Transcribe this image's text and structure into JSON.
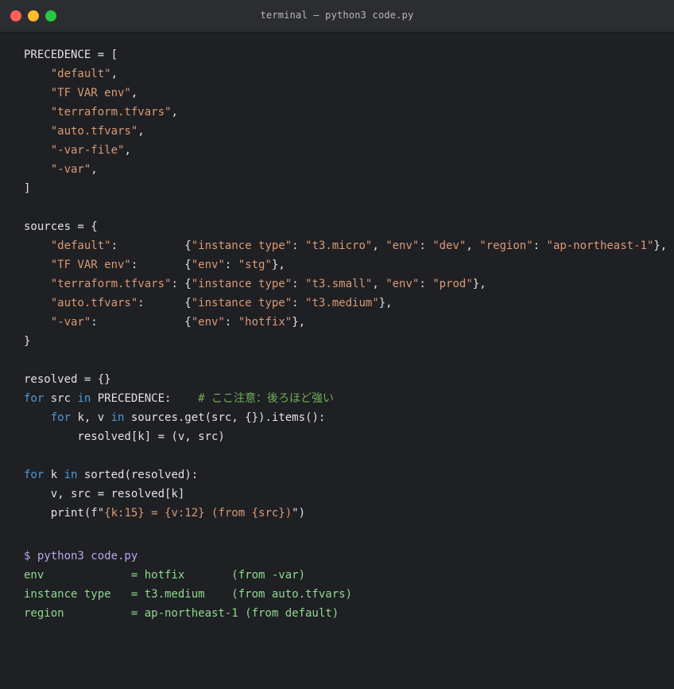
{
  "window": {
    "title": "terminal — python3 code.py"
  },
  "code_lines": [
    [
      {
        "t": "PRECEDENCE = [",
        "c": ""
      }
    ],
    [
      {
        "t": "    ",
        "c": ""
      },
      {
        "t": "\"default\"",
        "c": "str"
      },
      {
        "t": ",",
        "c": ""
      }
    ],
    [
      {
        "t": "    ",
        "c": ""
      },
      {
        "t": "\"TF VAR env\"",
        "c": "str"
      },
      {
        "t": ",",
        "c": ""
      }
    ],
    [
      {
        "t": "    ",
        "c": ""
      },
      {
        "t": "\"terraform.tfvars\"",
        "c": "str"
      },
      {
        "t": ",",
        "c": ""
      }
    ],
    [
      {
        "t": "    ",
        "c": ""
      },
      {
        "t": "\"auto.tfvars\"",
        "c": "str"
      },
      {
        "t": ",",
        "c": ""
      }
    ],
    [
      {
        "t": "    ",
        "c": ""
      },
      {
        "t": "\"-var-file\"",
        "c": "str"
      },
      {
        "t": ",",
        "c": ""
      }
    ],
    [
      {
        "t": "    ",
        "c": ""
      },
      {
        "t": "\"-var\"",
        "c": "str"
      },
      {
        "t": ",",
        "c": ""
      }
    ],
    [
      {
        "t": "]",
        "c": ""
      }
    ],
    [
      {
        "t": "",
        "c": ""
      }
    ],
    [
      {
        "t": "sources = {",
        "c": ""
      }
    ],
    [
      {
        "t": "    ",
        "c": ""
      },
      {
        "t": "\"default\"",
        "c": "str"
      },
      {
        "t": ":          {",
        "c": ""
      },
      {
        "t": "\"instance type\"",
        "c": "str"
      },
      {
        "t": ": ",
        "c": ""
      },
      {
        "t": "\"t3.micro\"",
        "c": "str"
      },
      {
        "t": ", ",
        "c": ""
      },
      {
        "t": "\"env\"",
        "c": "str"
      },
      {
        "t": ": ",
        "c": ""
      },
      {
        "t": "\"dev\"",
        "c": "str"
      },
      {
        "t": ", ",
        "c": ""
      },
      {
        "t": "\"region\"",
        "c": "str"
      },
      {
        "t": ": ",
        "c": ""
      },
      {
        "t": "\"ap-northeast-1\"",
        "c": "str"
      },
      {
        "t": "},",
        "c": ""
      }
    ],
    [
      {
        "t": "    ",
        "c": ""
      },
      {
        "t": "\"TF VAR env\"",
        "c": "str"
      },
      {
        "t": ":       {",
        "c": ""
      },
      {
        "t": "\"env\"",
        "c": "str"
      },
      {
        "t": ": ",
        "c": ""
      },
      {
        "t": "\"stg\"",
        "c": "str"
      },
      {
        "t": "},",
        "c": ""
      }
    ],
    [
      {
        "t": "    ",
        "c": ""
      },
      {
        "t": "\"terraform.tfvars\"",
        "c": "str"
      },
      {
        "t": ": {",
        "c": ""
      },
      {
        "t": "\"instance type\"",
        "c": "str"
      },
      {
        "t": ": ",
        "c": ""
      },
      {
        "t": "\"t3.small\"",
        "c": "str"
      },
      {
        "t": ", ",
        "c": ""
      },
      {
        "t": "\"env\"",
        "c": "str"
      },
      {
        "t": ": ",
        "c": ""
      },
      {
        "t": "\"prod\"",
        "c": "str"
      },
      {
        "t": "},",
        "c": ""
      }
    ],
    [
      {
        "t": "    ",
        "c": ""
      },
      {
        "t": "\"auto.tfvars\"",
        "c": "str"
      },
      {
        "t": ":      {",
        "c": ""
      },
      {
        "t": "\"instance type\"",
        "c": "str"
      },
      {
        "t": ": ",
        "c": ""
      },
      {
        "t": "\"t3.medium\"",
        "c": "str"
      },
      {
        "t": "},",
        "c": ""
      }
    ],
    [
      {
        "t": "    ",
        "c": ""
      },
      {
        "t": "\"-var\"",
        "c": "str"
      },
      {
        "t": ":             {",
        "c": ""
      },
      {
        "t": "\"env\"",
        "c": "str"
      },
      {
        "t": ": ",
        "c": ""
      },
      {
        "t": "\"hotfix\"",
        "c": "str"
      },
      {
        "t": "},",
        "c": ""
      }
    ],
    [
      {
        "t": "}",
        "c": ""
      }
    ],
    [
      {
        "t": "",
        "c": ""
      }
    ],
    [
      {
        "t": "resolved = {}",
        "c": ""
      }
    ],
    [
      {
        "t": "for",
        "c": "kw"
      },
      {
        "t": " src ",
        "c": ""
      },
      {
        "t": "in",
        "c": "kw"
      },
      {
        "t": " PRECEDENCE:    ",
        "c": ""
      },
      {
        "t": "# ここ注意：後ろほど強い",
        "c": "cm"
      }
    ],
    [
      {
        "t": "    ",
        "c": ""
      },
      {
        "t": "for",
        "c": "kw"
      },
      {
        "t": " k, v ",
        "c": ""
      },
      {
        "t": "in",
        "c": "kw"
      },
      {
        "t": " sources.get(src, {}).items():",
        "c": ""
      }
    ],
    [
      {
        "t": "        resolved[k] = (v, src)",
        "c": ""
      }
    ],
    [
      {
        "t": "",
        "c": ""
      }
    ],
    [
      {
        "t": "for",
        "c": "kw"
      },
      {
        "t": " k ",
        "c": ""
      },
      {
        "t": "in",
        "c": "kw"
      },
      {
        "t": " sorted(resolved):",
        "c": ""
      }
    ],
    [
      {
        "t": "    v, src = resolved[k]",
        "c": ""
      }
    ],
    [
      {
        "t": "    print(f\"",
        "c": ""
      },
      {
        "t": "{k:15} = {v:12} (from {src})",
        "c": "str"
      },
      {
        "t": "\")",
        "c": ""
      }
    ]
  ],
  "terminal": {
    "command": "$ python3 code.py",
    "output_lines": [
      "env             = hotfix       (from -var)",
      "instance type   = t3.medium    (from auto.tfvars)",
      "region          = ap-northeast-1 (from default)"
    ]
  },
  "colors": {
    "background": "#1f2024",
    "titlebar": "#2c2d31",
    "text": "#e2e2e2",
    "string": "#d99a75",
    "keyword": "#4e9ad8",
    "comment": "#6fae5a",
    "prompt": "#b8a6ea",
    "output": "#8fd98e"
  }
}
